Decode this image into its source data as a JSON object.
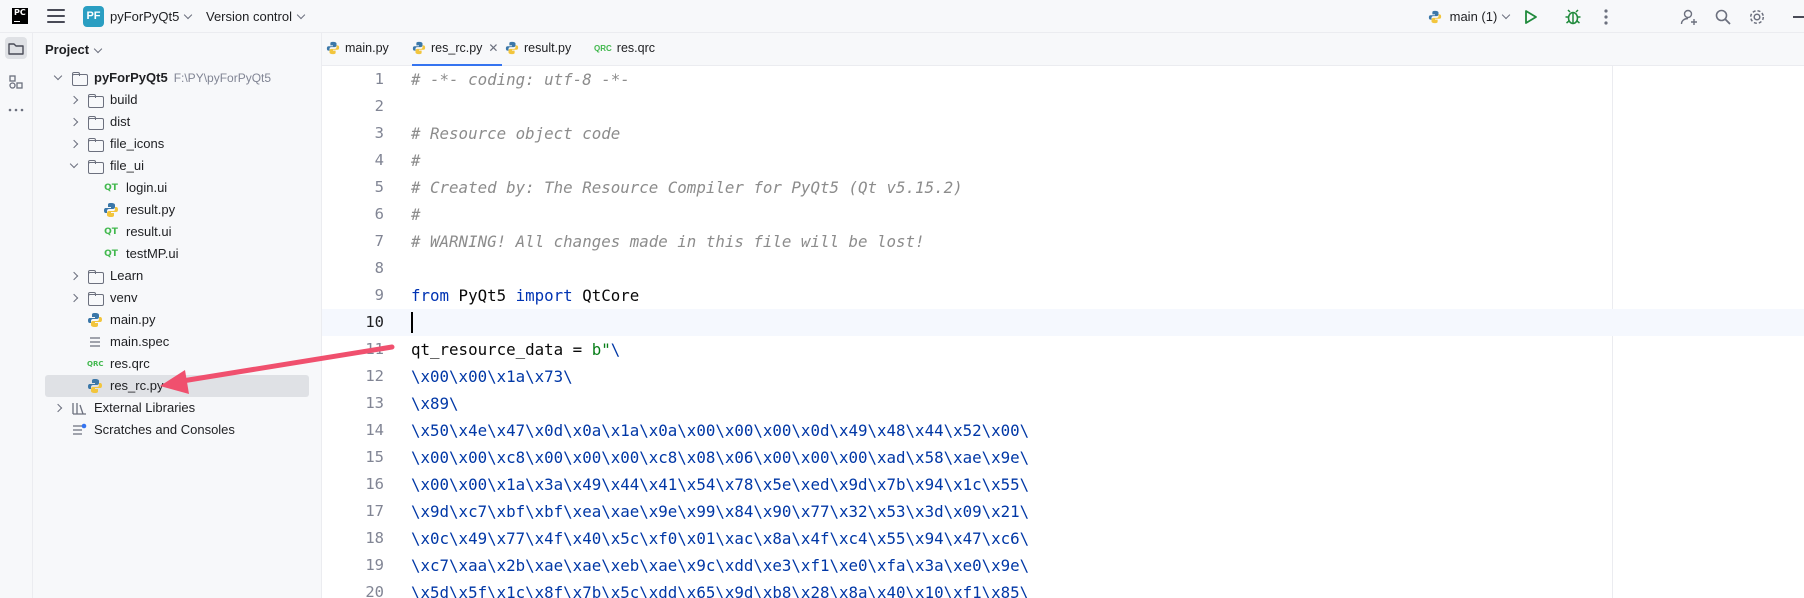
{
  "titlebar": {
    "logo": "PC",
    "project_badge": "PF",
    "project_name": "pyForPyQt5",
    "vcs": "Version control",
    "run_config": "main (1)"
  },
  "project_panel": {
    "title": "Project",
    "root": {
      "name": "pyForPyQt5",
      "path": "F:\\PY\\pyForPyQt5"
    },
    "items": [
      {
        "label": "build",
        "type": "folder"
      },
      {
        "label": "dist",
        "type": "folder"
      },
      {
        "label": "file_icons",
        "type": "folder"
      },
      {
        "label": "file_ui",
        "type": "folder"
      },
      {
        "label": "login.ui",
        "type": "qt"
      },
      {
        "label": "result.py",
        "type": "python"
      },
      {
        "label": "result.ui",
        "type": "qt"
      },
      {
        "label": "testMP.ui",
        "type": "qt"
      },
      {
        "label": "Learn",
        "type": "folder"
      },
      {
        "label": "venv",
        "type": "folder"
      },
      {
        "label": "main.py",
        "type": "python"
      },
      {
        "label": "main.spec",
        "type": "text"
      },
      {
        "label": "res.qrc",
        "type": "qrc"
      },
      {
        "label": "res_rc.py",
        "type": "python"
      },
      {
        "label": "External Libraries",
        "type": "library"
      },
      {
        "label": "Scratches and Consoles",
        "type": "scratches"
      }
    ]
  },
  "tabs": [
    {
      "label": "main.py",
      "icon": "python-icon"
    },
    {
      "label": "res_rc.py",
      "icon": "python-icon",
      "active": true
    },
    {
      "label": "result.py",
      "icon": "python-icon"
    },
    {
      "label": "res.qrc",
      "icon": "qrc-icon"
    }
  ],
  "editor": {
    "current_line": 10,
    "lines": [
      {
        "n": "1",
        "text": "# -*- coding: utf-8 -*-",
        "kind": "comment"
      },
      {
        "n": "2",
        "text": "",
        "kind": "plain"
      },
      {
        "n": "3",
        "text": "# Resource object code",
        "kind": "comment"
      },
      {
        "n": "4",
        "text": "#",
        "kind": "comment"
      },
      {
        "n": "5",
        "text": "# Created by: The Resource Compiler for PyQt5 (Qt v5.15.2)",
        "kind": "comment"
      },
      {
        "n": "6",
        "text": "#",
        "kind": "comment"
      },
      {
        "n": "7",
        "text": "# WARNING! All changes made in this file will be lost!",
        "kind": "comment"
      },
      {
        "n": "8",
        "text": "",
        "kind": "plain"
      },
      {
        "n": "9",
        "text": "from PyQt5 import QtCore",
        "kind": "import"
      },
      {
        "n": "10",
        "text": "",
        "kind": "plain"
      },
      {
        "n": "11",
        "text": "qt_resource_data = b\"\\",
        "kind": "assign"
      },
      {
        "n": "12",
        "text": "\\x00\\x00\\x1a\\x73\\",
        "kind": "escape"
      },
      {
        "n": "13",
        "text": "\\x89\\",
        "kind": "escape"
      },
      {
        "n": "14",
        "text": "\\x50\\x4e\\x47\\x0d\\x0a\\x1a\\x0a\\x00\\x00\\x00\\x0d\\x49\\x48\\x44\\x52\\x00\\",
        "kind": "escape"
      },
      {
        "n": "15",
        "text": "\\x00\\x00\\xc8\\x00\\x00\\x00\\xc8\\x08\\x06\\x00\\x00\\x00\\xad\\x58\\xae\\x9e\\",
        "kind": "escape"
      },
      {
        "n": "16",
        "text": "\\x00\\x00\\x1a\\x3a\\x49\\x44\\x41\\x54\\x78\\x5e\\xed\\x9d\\x7b\\x94\\x1c\\x55\\",
        "kind": "escape"
      },
      {
        "n": "17",
        "text": "\\x9d\\xc7\\xbf\\xbf\\xea\\xae\\x9e\\x99\\x84\\x90\\x77\\x32\\x53\\x3d\\x09\\x21\\",
        "kind": "escape"
      },
      {
        "n": "18",
        "text": "\\x0c\\x49\\x77\\x4f\\x40\\x5c\\xf0\\x01\\xac\\x8a\\x4f\\xc4\\x55\\x94\\x47\\xc6\\",
        "kind": "escape"
      },
      {
        "n": "19",
        "text": "\\xc7\\xaa\\x2b\\xae\\xae\\xeb\\xae\\x9c\\xdd\\xe3\\xf1\\xe0\\xfa\\x3a\\xe0\\x9e\\",
        "kind": "escape"
      },
      {
        "n": "20",
        "text": "\\x5d\\x5f\\x1c\\x8f\\x7b\\x5c\\xdd\\x65\\x9d\\xb8\\x28\\x8a\\x40\\x10\\xf1\\x85\\",
        "kind": "escape"
      }
    ]
  },
  "colors": {
    "accent": "#3574f0",
    "annotation_arrow": "#f0506e",
    "keyword": "#0033b3",
    "comment": "#8c8c8c",
    "string": "#067d17"
  }
}
